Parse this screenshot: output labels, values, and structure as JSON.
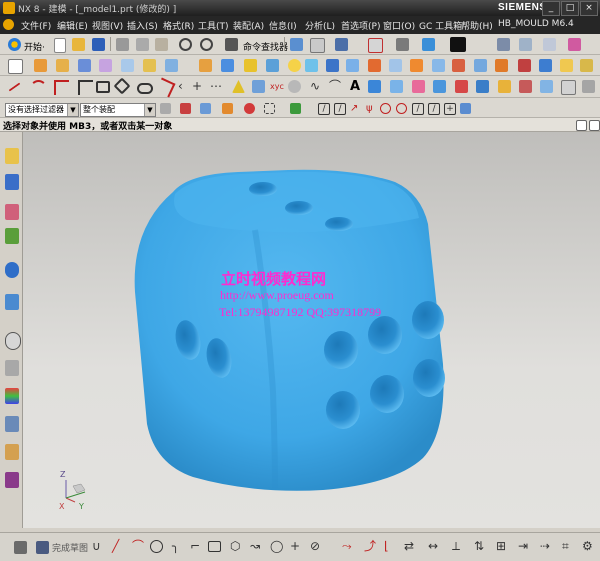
{
  "window": {
    "title": "NX 8 - 建模 - [_model1.prt  (修改的) ]",
    "brand": "SIEMENS",
    "controls": [
      "_",
      "□",
      "×"
    ]
  },
  "menu": [
    "文件(F)",
    "编辑(E)",
    "视图(V)",
    "插入(S)",
    "格式(R)",
    "工具(T)",
    "装配(A)",
    "信息(I)",
    "分析(L)",
    "首选项(P)",
    "窗口(O)",
    "GC 工具箱",
    "帮助(H)",
    "HB_MOULD M6.4"
  ],
  "toolbar": {
    "start_label": "开始·",
    "command_finder_label": "命令查找器"
  },
  "selection": {
    "filter_value": "没有选择过滤器",
    "scope_value": "整个装配"
  },
  "cue_line": "选择对象并使用 MB3，或者双击某一对象",
  "watermark": {
    "line1": "立时视频教程网",
    "line2": "http://www.proeug.com",
    "line3": "Tel:13794987192   QQ:397318799"
  },
  "triad": {
    "z_label": "Z",
    "x_label": "X",
    "y_label": "Y"
  },
  "bottom": {
    "sketch_label": "完成草图"
  },
  "colors": {
    "dice": "#3ea7e6",
    "title_bar": "#1e1e1e",
    "watermark": "#ff3cc8"
  }
}
